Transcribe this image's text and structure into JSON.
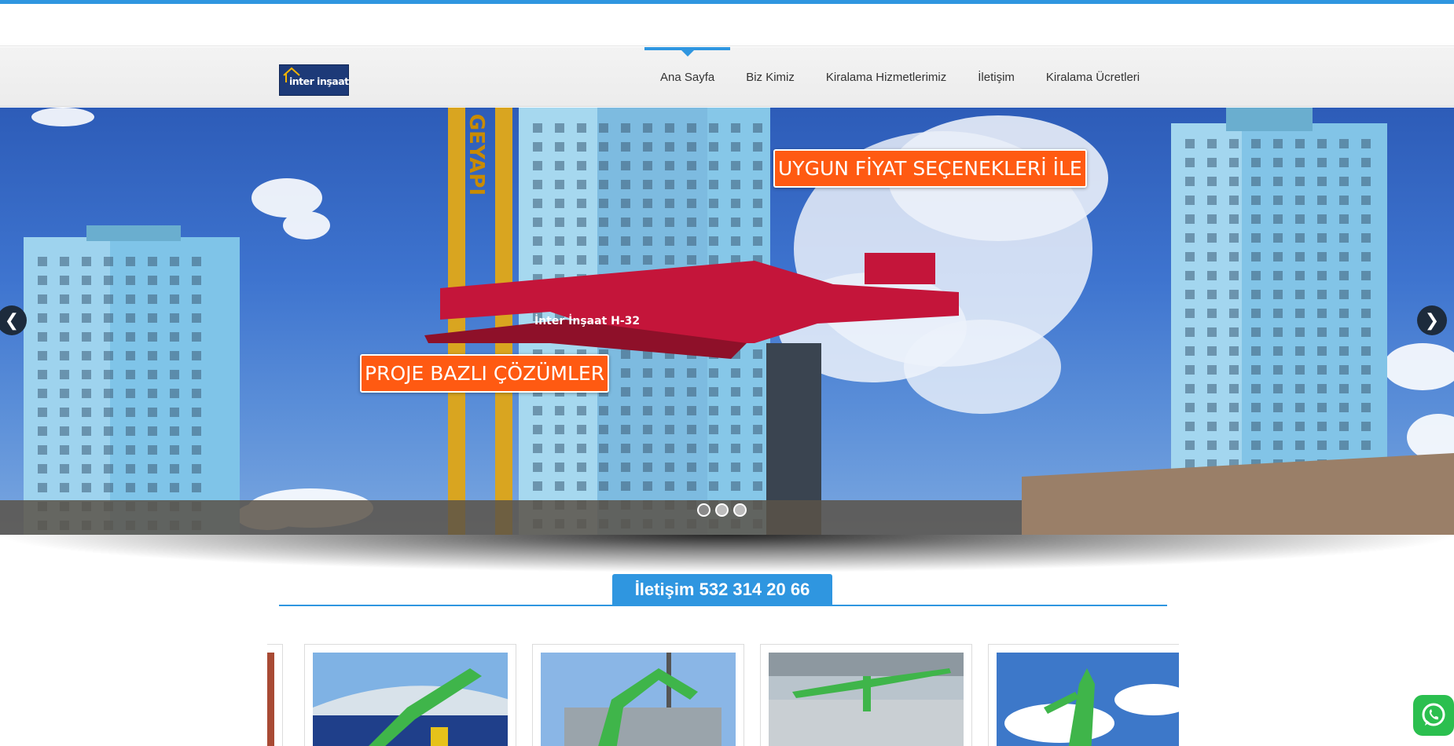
{
  "header": {
    "logo_text_a": "inter",
    "logo_text_b": "inşaat",
    "nav": [
      {
        "label": "Ana Sayfa",
        "active": true
      },
      {
        "label": "Biz Kimiz"
      },
      {
        "label": "Kiralama Hizmetlerimiz"
      },
      {
        "label": "İletişim"
      },
      {
        "label": "Kiralama Ücretleri"
      }
    ]
  },
  "slider": {
    "caption_top": "UYGUN FİYAT SEÇENEKLERİ İLE",
    "caption_bottom": "PROJE BAZLI ÇÖZÜMLER",
    "machine_label": "İnter İnşaat H-32",
    "crane_text": "GEYAPI",
    "prev_icon": "chevron-left-icon",
    "next_icon": "chevron-right-icon",
    "dots_count": 3,
    "active_dot": 1
  },
  "contact": {
    "label": "İletişim 532 314 20 66"
  },
  "floating": {
    "whatsapp_icon": "whatsapp-icon"
  },
  "colors": {
    "accent": "#2f96e0",
    "caption_bg": "#ff5a12",
    "machine_green": "#3fb54a",
    "machine_red": "#c4153a"
  }
}
